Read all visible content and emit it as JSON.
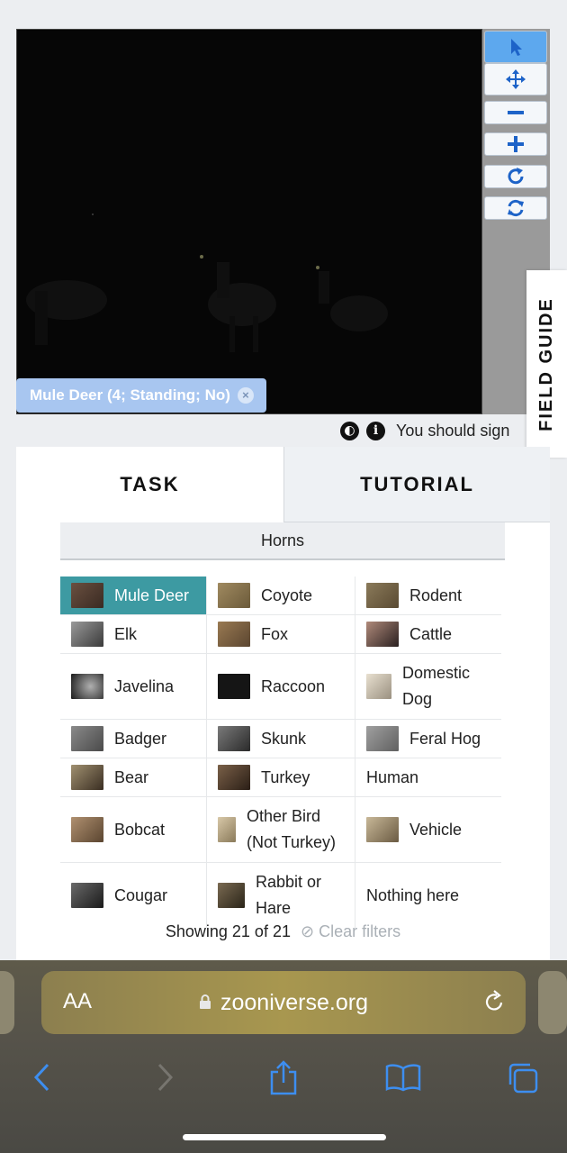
{
  "viewer": {
    "annotation_tag": "Mule Deer (4; Standing; No)",
    "tools": [
      "pointer-icon",
      "pan-icon",
      "zoom-out-icon",
      "zoom-in-icon",
      "rotate-icon",
      "reset-icon"
    ]
  },
  "field_guide": {
    "label": "FIELD GUIDE"
  },
  "info_row": {
    "message": "You should sign"
  },
  "tabs": {
    "task": "TASK",
    "tutorial": "TUTORIAL"
  },
  "filter": {
    "label": "Horns"
  },
  "choices": [
    [
      "Mule Deer",
      "Coyote",
      "Rodent"
    ],
    [
      "Elk",
      "Fox",
      "Cattle"
    ],
    [
      "Javelina",
      "Raccoon",
      "Domestic Dog"
    ],
    [
      "Badger",
      "Skunk",
      "Feral Hog"
    ],
    [
      "Bear",
      "Turkey",
      "Human"
    ],
    [
      "Bobcat",
      "Other Bird (Not Turkey)",
      "Vehicle"
    ],
    [
      "Cougar",
      "Rabbit or Hare",
      "Nothing here"
    ]
  ],
  "footer": {
    "showing": "Showing 21 of 21",
    "clear_filters": "Clear filters"
  },
  "browser": {
    "text_size": "AA",
    "url": "zooniverse.org"
  },
  "colors": {
    "selected_choice": "#3d9aa2",
    "active_tool": "#5da8ee",
    "tag": "#a8c6f0"
  }
}
